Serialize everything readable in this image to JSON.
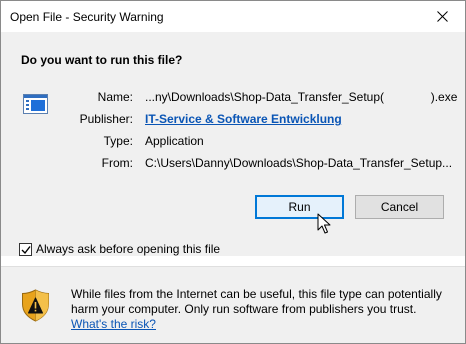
{
  "window": {
    "title": "Open File - Security Warning"
  },
  "prompt": {
    "question": "Do you want to run this file?"
  },
  "file_info": {
    "name_label": "Name:",
    "name_value": "...ny\\Downloads\\Shop-Data_Transfer_Setup(              ).exe",
    "publisher_label": "Publisher:",
    "publisher_value": "IT-Service & Software Entwicklung",
    "type_label": "Type:",
    "type_value": "Application",
    "from_label": "From:",
    "from_value": "C:\\Users\\Danny\\Downloads\\Shop-Data_Transfer_Setup..."
  },
  "buttons": {
    "run_label": "Run",
    "cancel_label": "Cancel"
  },
  "checkbox": {
    "label": "Always ask before opening this file",
    "checked": true
  },
  "warning": {
    "text": "While files from the Internet can be useful, this file type can potentially harm your computer. Only run software from publishers you trust. ",
    "link_text": "What's the risk?"
  },
  "colors": {
    "link": "#0a55b5",
    "default_button_border": "#0078d7",
    "panel_background": "#f0f0f0"
  },
  "icons": {
    "close": "close-icon",
    "file": "application-file-icon",
    "shield": "security-shield-icon",
    "cursor": "mouse-pointer-icon"
  }
}
